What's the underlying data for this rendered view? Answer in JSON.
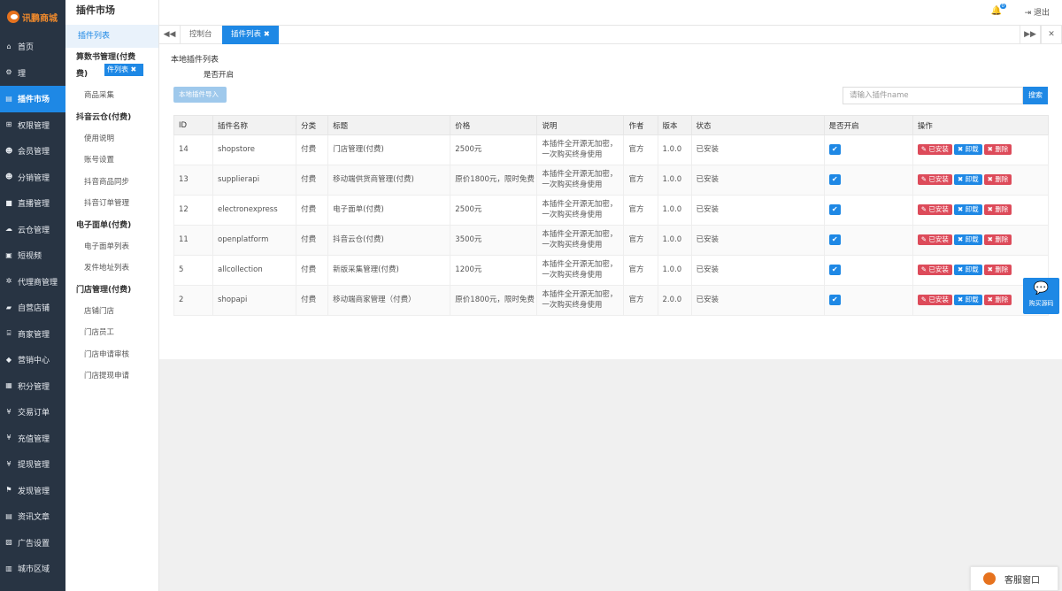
{
  "brand": {
    "name": "讯鹏商城"
  },
  "sidebar": {
    "items": [
      {
        "label": "首页",
        "icon": "home-icon",
        "glyph": "⌂"
      },
      {
        "label": "理",
        "icon": "gear-icon",
        "glyph": "⚙"
      },
      {
        "label": "插件市场",
        "icon": "plugin-icon",
        "glyph": "▤"
      },
      {
        "label": "权限管理",
        "icon": "sitemap-icon",
        "glyph": "⊞"
      },
      {
        "label": "会员管理",
        "icon": "users-icon",
        "glyph": "☻"
      },
      {
        "label": "分销管理",
        "icon": "users-icon",
        "glyph": "☻"
      },
      {
        "label": "直播管理",
        "icon": "video-icon",
        "glyph": "■"
      },
      {
        "label": "云仓管理",
        "icon": "cloud-icon",
        "glyph": "☁"
      },
      {
        "label": "短视频",
        "icon": "film-icon",
        "glyph": "▣"
      },
      {
        "label": "代理商管理",
        "icon": "gears-icon",
        "glyph": "✲"
      },
      {
        "label": "自营店铺",
        "icon": "truck-icon",
        "glyph": "▰"
      },
      {
        "label": "商家管理",
        "icon": "bank-icon",
        "glyph": "⌸"
      },
      {
        "label": "营销中心",
        "icon": "diamond-icon",
        "glyph": "◆"
      },
      {
        "label": "积分管理",
        "icon": "calculator-icon",
        "glyph": "▦"
      },
      {
        "label": "交易订单",
        "icon": "yen-icon",
        "glyph": "¥"
      },
      {
        "label": "充值管理",
        "icon": "yen-icon",
        "glyph": "¥"
      },
      {
        "label": "提现管理",
        "icon": "yen-icon",
        "glyph": "¥"
      },
      {
        "label": "发现管理",
        "icon": "flag-icon",
        "glyph": "⚑"
      },
      {
        "label": "资讯文章",
        "icon": "newspaper-icon",
        "glyph": "▤"
      },
      {
        "label": "广告设置",
        "icon": "image-icon",
        "glyph": "▨"
      },
      {
        "label": "城市区域",
        "icon": "map-icon",
        "glyph": "▥"
      }
    ]
  },
  "subnav": {
    "title": "插件市场",
    "active": "插件列表",
    "group1_title_a": "算数书管理(付费",
    "group1_title_b": "费)",
    "groups": [
      {
        "title": "",
        "links": [
          "商品采集"
        ]
      },
      {
        "title": "抖音云仓(付费)",
        "links": [
          "使用说明",
          "账号设置",
          "抖音商品同步",
          "抖音订单管理"
        ]
      },
      {
        "title": "电子面单(付费)",
        "links": [
          "电子面单列表",
          "发件地址列表"
        ]
      },
      {
        "title": "门店管理(付费)",
        "links": [
          "店铺门店",
          "门店员工",
          "门店申请审核",
          "门店提现申请"
        ]
      }
    ]
  },
  "floating": {
    "tab": "件列表 ✖",
    "import": "本地插件导入"
  },
  "header": {
    "notify_count": "0",
    "logout": "退出"
  },
  "tabs": {
    "home": "控制台",
    "active": "插件列表 ✖"
  },
  "panel": {
    "title": "本地插件列表",
    "subtitle": "是否开启",
    "search_placeholder": "请输入插件name",
    "search_button": "搜索"
  },
  "table": {
    "headers": [
      "ID",
      "插件名称",
      "分类",
      "标题",
      "价格",
      "说明",
      "作者",
      "版本",
      "状态",
      "是否开启",
      "操作"
    ],
    "rows": [
      {
        "id": "14",
        "name": "shopstore",
        "type": "付费",
        "title": "门店管理(付费)",
        "price": "2500元",
        "desc_a": "本插件全开源无加密，",
        "desc_b": "一次购买终身使用",
        "author": "官方",
        "version": "1.0.0",
        "status": "已安装"
      },
      {
        "id": "13",
        "name": "supplierapi",
        "type": "付费",
        "title": "移动端供货商管理(付费)",
        "price": "原价1800元，限时免费",
        "desc_a": "本插件全开源无加密，",
        "desc_b": "一次购买终身使用",
        "author": "官方",
        "version": "1.0.0",
        "status": "已安装"
      },
      {
        "id": "12",
        "name": "electronexpress",
        "type": "付费",
        "title": "电子面单(付费)",
        "price": "2500元",
        "desc_a": "本插件全开源无加密，",
        "desc_b": "一次购买终身使用",
        "author": "官方",
        "version": "1.0.0",
        "status": "已安装"
      },
      {
        "id": "11",
        "name": "openplatform",
        "type": "付费",
        "title": "抖音云仓(付费)",
        "price": "3500元",
        "desc_a": "本插件全开源无加密，",
        "desc_b": "一次购买终身使用",
        "author": "官方",
        "version": "1.0.0",
        "status": "已安装"
      },
      {
        "id": "5",
        "name": "allcollection",
        "type": "付费",
        "title": "新版采集管理(付费)",
        "price": "1200元",
        "desc_a": "本插件全开源无加密，",
        "desc_b": "一次购买终身使用",
        "author": "官方",
        "version": "1.0.0",
        "status": "已安装"
      },
      {
        "id": "2",
        "name": "shopapi",
        "type": "付费",
        "title": "移动端商家管理（付费）",
        "price": "原价1800元，限时免费",
        "desc_a": "本插件全开源无加密，",
        "desc_b": "一次购买终身使用",
        "author": "官方",
        "version": "2.0.0",
        "status": "已安装"
      }
    ],
    "actions": {
      "installed": "✎ 已安装",
      "uninstall": "✖ 卸载",
      "delete": "✖ 删除"
    }
  },
  "widgets": {
    "buy": "购买源码",
    "service": "客服窗口"
  },
  "colors": {
    "sidebar": "#283443",
    "primary": "#1e88e5",
    "danger": "#dd4b5a",
    "brand": "#e6721e"
  }
}
